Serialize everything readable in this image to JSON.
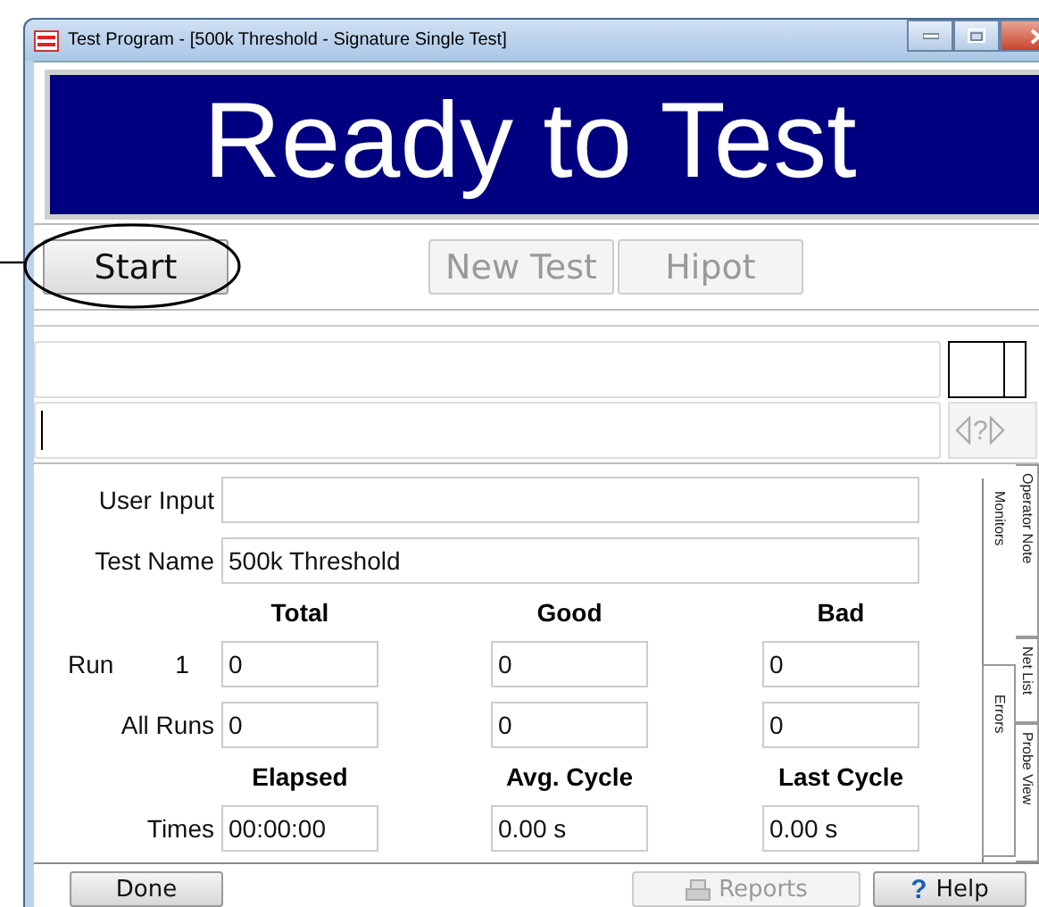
{
  "window": {
    "title": "Test Program - [500k Threshold - Signature Single Test]"
  },
  "status_banner": {
    "text": "Ready to Test"
  },
  "toolbar": {
    "buttons": [
      {
        "label": "Start",
        "disabled": false,
        "circled": true
      },
      {
        "label": "New Test",
        "disabled": true,
        "circled": false
      },
      {
        "label": "Hipot",
        "disabled": true,
        "circled": false
      }
    ]
  },
  "form": {
    "user_input": {
      "label": "User Input"
    },
    "test_name": {
      "label": "Test Name",
      "value": "500k Threshold"
    },
    "count_columns": [
      "Total",
      "Good",
      "Bad"
    ],
    "count_rows": [
      {
        "label": "Run",
        "run_number": "1",
        "values": [
          "0",
          "0",
          "0"
        ]
      },
      {
        "label": "All Runs",
        "values": [
          "0",
          "0",
          "0"
        ]
      }
    ],
    "time_columns": [
      "Elapsed",
      "Avg. Cycle",
      "Last Cycle"
    ],
    "time_row": {
      "label": "Times",
      "values": [
        "00:00:00",
        "0.00 s",
        "0.00 s"
      ]
    }
  },
  "side_tabs": {
    "inner": [
      {
        "label": "Monitors",
        "selected": true
      },
      {
        "label": "Errors",
        "selected": false
      }
    ],
    "outer": [
      {
        "label": "Operator Note",
        "selected": false
      },
      {
        "label": "Net List",
        "selected": false
      },
      {
        "label": "Probe View",
        "selected": false
      }
    ]
  },
  "footer_buttons": [
    {
      "label": "Done",
      "disabled": false,
      "kind": "plain"
    },
    {
      "label": "Reports",
      "disabled": true,
      "kind": "print"
    },
    {
      "label": "Help",
      "disabled": false,
      "kind": "help",
      "symbol": "?"
    }
  ],
  "navigator": {
    "symbol": "?"
  }
}
